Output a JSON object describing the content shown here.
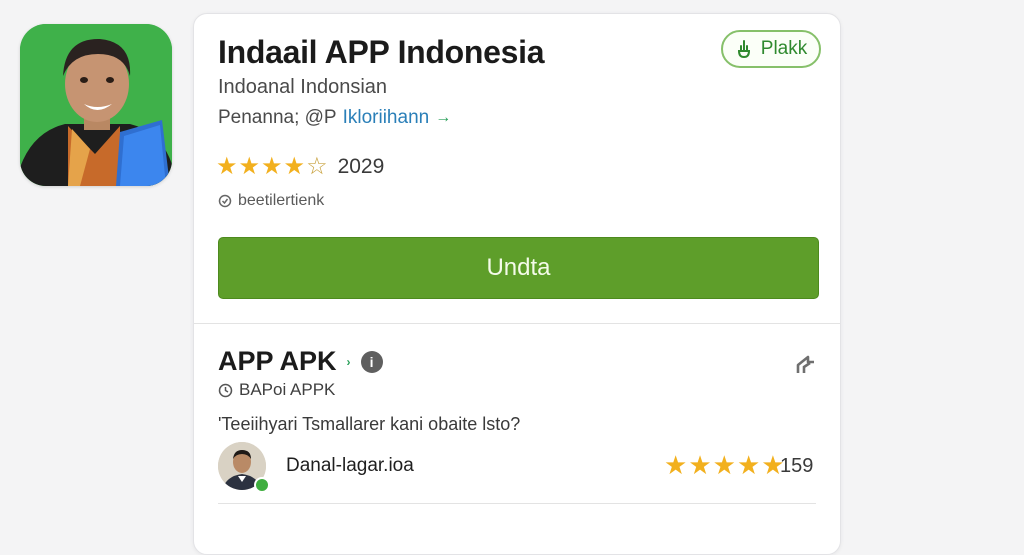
{
  "app": {
    "title": "Indaail APP Indonesia",
    "subtitle": "Indoanal Indonsian",
    "publisher_label": "Penanna; @P",
    "publisher_link": "Ikloriihann",
    "publisher_arrow": "→",
    "rating": {
      "stars": 3.5,
      "max": 5,
      "count": "2029"
    },
    "meta_text": "beetilertienk",
    "pill_button_label": "Plakk",
    "install_label": "Undta",
    "icon": "app-icon-person-portrait"
  },
  "section": {
    "title": "APP APK",
    "marker": "›",
    "info_icon": "i",
    "subtitle": "BAPoi APPK",
    "question": "'Teeiihyari Tsmallarer kani obaite lsto?"
  },
  "review": {
    "reviewer": "Danal-lagar.ioa",
    "stars": 5,
    "count": "159"
  },
  "colors": {
    "accent_green": "#5e9e2a",
    "pill_green": "#2f8a2f",
    "star_gold": "#f2b01e",
    "link_blue": "#2a7fb8"
  }
}
